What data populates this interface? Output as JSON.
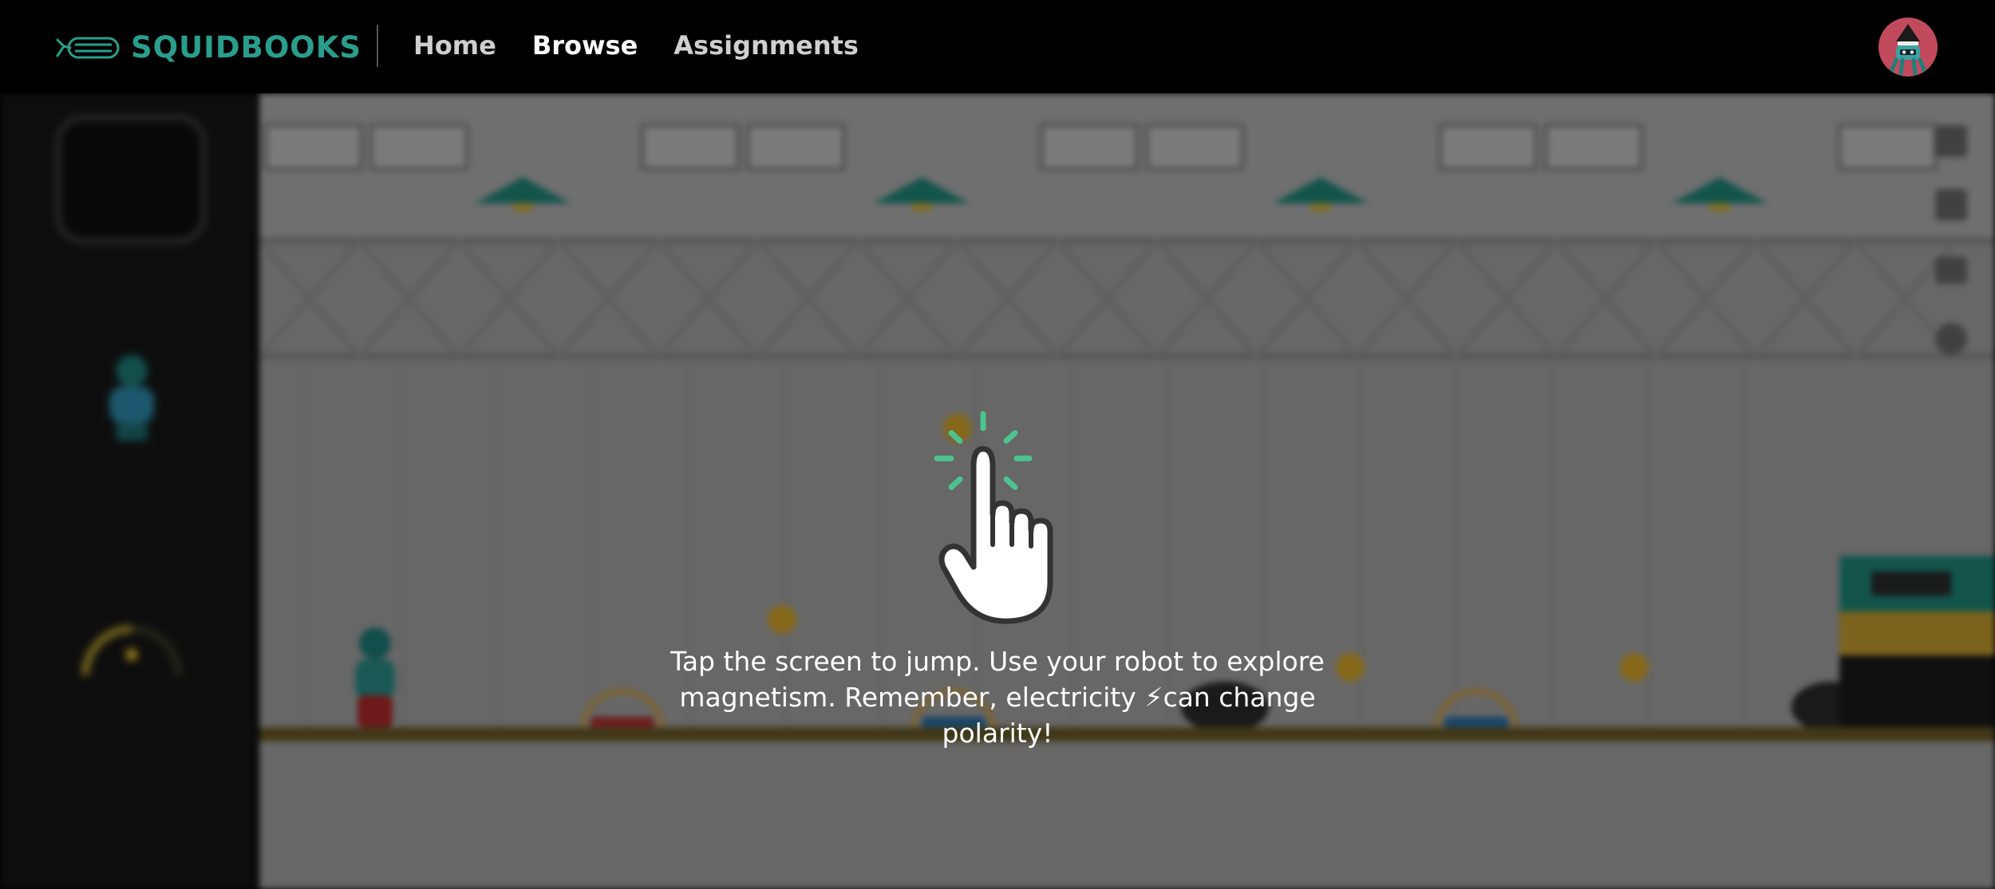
{
  "brand": {
    "squid": "SQUID",
    "books": "BOOKS"
  },
  "nav": [
    {
      "label": "Home",
      "active": false
    },
    {
      "label": "Browse",
      "active": true
    },
    {
      "label": "Assignments",
      "active": false
    }
  ],
  "game": {
    "instructions": {
      "line1": "Tap the screen to jump. Use your robot to explore",
      "line2": "magnetism. Remember, electricity ⚡can change polarity!"
    }
  },
  "colors": {
    "brand_teal": "#2a9e8c",
    "tap_accent": "#4cc38f",
    "avatar_bg": "#c14a5c",
    "coin_gold": "#e3bb2a"
  },
  "icons": [
    "whale-logo-icon",
    "tap-hand-icon",
    "avatar-icon"
  ]
}
